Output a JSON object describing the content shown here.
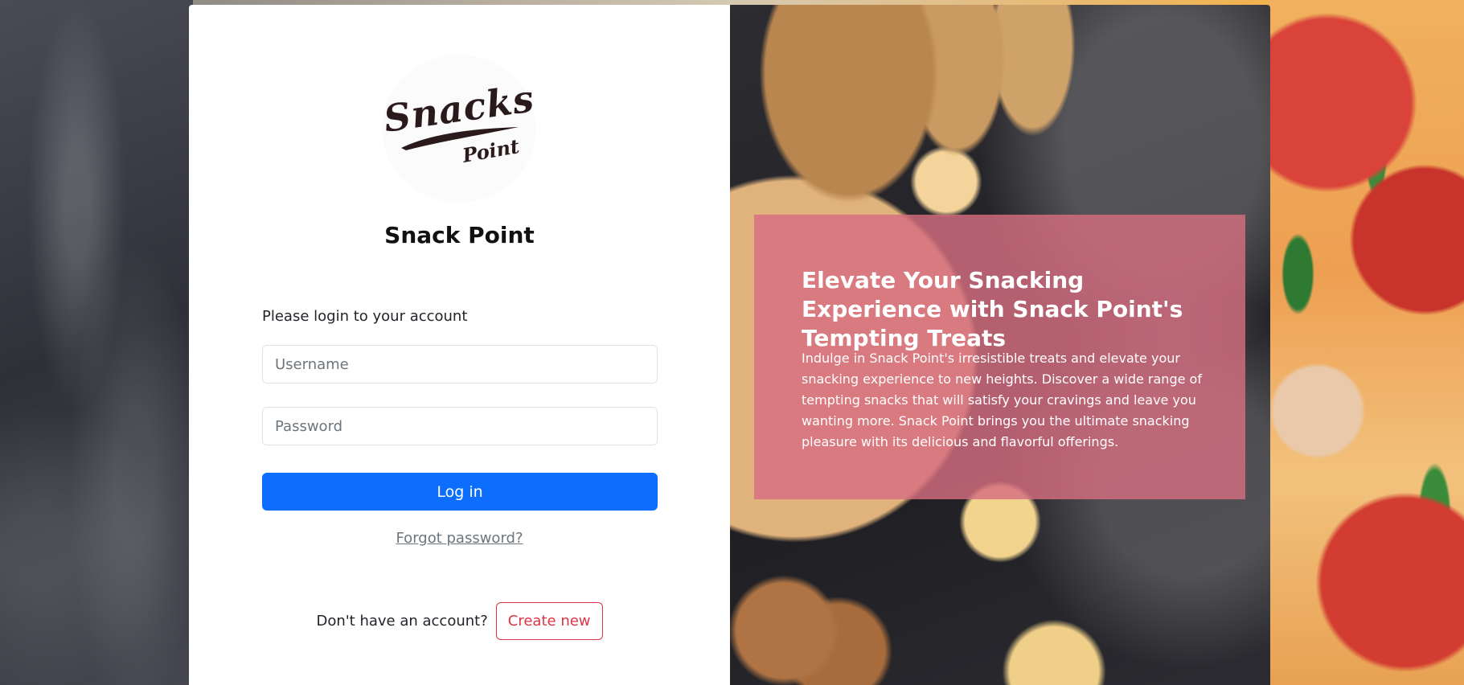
{
  "logo": {
    "text_main": "Snacks",
    "text_sub": "Point"
  },
  "brand": {
    "name": "Snack Point"
  },
  "login_form": {
    "prompt": "Please login to your account",
    "username_placeholder": "Username",
    "password_placeholder": "Password",
    "login_label": "Log in",
    "forgot_label": "Forgot password?",
    "signup_prompt": "Don't have an account?",
    "create_label": "Create new"
  },
  "promo": {
    "title": "Elevate Your Snacking Experience with Snack Point's Tempting Treats",
    "body": "Indulge in Snack Point's irresistible treats and elevate your snacking experience to new heights. Discover a wide range of tempting snacks that will satisfy your cravings and leave you wanting more. Snack Point brings you the ultimate snacking pleasure with its delicious and flavorful offerings."
  },
  "colors": {
    "primary_button": "#0d6efd",
    "danger_outline": "#dc3545",
    "promo_overlay": "#d66e80"
  }
}
